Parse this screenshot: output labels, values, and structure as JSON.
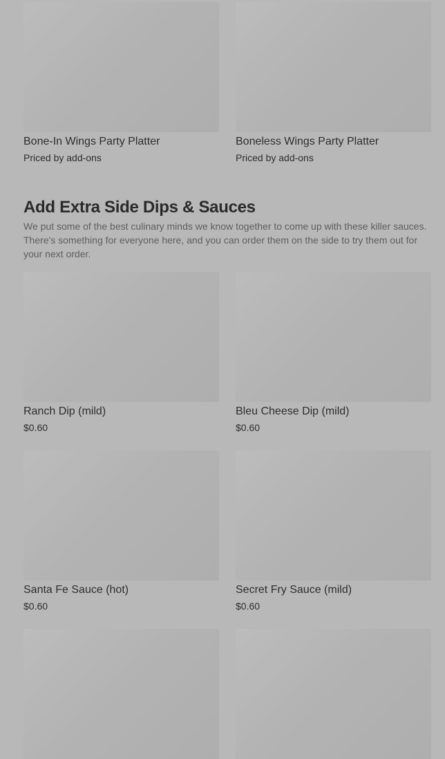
{
  "top_items": [
    {
      "name": "Bone-In Wings Party Platter",
      "price": "Priced by add-ons"
    },
    {
      "name": "Boneless Wings Party Platter",
      "price": "Priced by add-ons"
    }
  ],
  "section": {
    "title": "Add Extra Side Dips & Sauces",
    "description": "We put some of the best culinary minds we know together to come up with these killer sauces. There's something for everyone here, and you can order them on the side to try them out for your next order."
  },
  "items": [
    {
      "name": "Ranch Dip (mild)",
      "price": "$0.60"
    },
    {
      "name": "Bleu Cheese Dip (mild)",
      "price": "$0.60"
    },
    {
      "name": "Santa Fe Sauce (hot)",
      "price": "$0.60"
    },
    {
      "name": "Secret Fry Sauce (mild)",
      "price": "$0.60"
    }
  ]
}
